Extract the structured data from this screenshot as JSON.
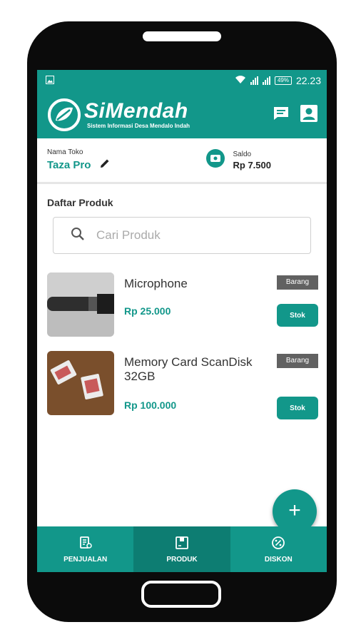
{
  "status_bar": {
    "battery": "49%",
    "time": "22.23"
  },
  "app": {
    "title": "SiMendah",
    "subtitle": "Sistem Informasi Desa Mendalo Indah"
  },
  "store": {
    "label": "Nama Toko",
    "name": "Taza Pro"
  },
  "balance": {
    "label": "Saldo",
    "value": "Rp 7.500"
  },
  "product_section": {
    "title": "Daftar Produk"
  },
  "search": {
    "placeholder": "Cari Produk"
  },
  "products": [
    {
      "name": "Microphone",
      "price": "Rp 25.000",
      "category": "Barang",
      "stock_button": "Stok"
    },
    {
      "name": "Memory Card ScanDisk 32GB",
      "price": "Rp 100.000",
      "category": "Barang",
      "stock_button": "Stok"
    }
  ],
  "fab": {
    "label": "+"
  },
  "bottom_nav": {
    "items": [
      {
        "label": "PENJUALAN",
        "icon": "receipt-icon"
      },
      {
        "label": "PRODUK",
        "icon": "box-icon",
        "active": true
      },
      {
        "label": "DISKON",
        "icon": "discount-icon"
      }
    ]
  },
  "colors": {
    "primary": "#12978a",
    "primary_dark": "#0d7d72",
    "badge": "#616161"
  }
}
